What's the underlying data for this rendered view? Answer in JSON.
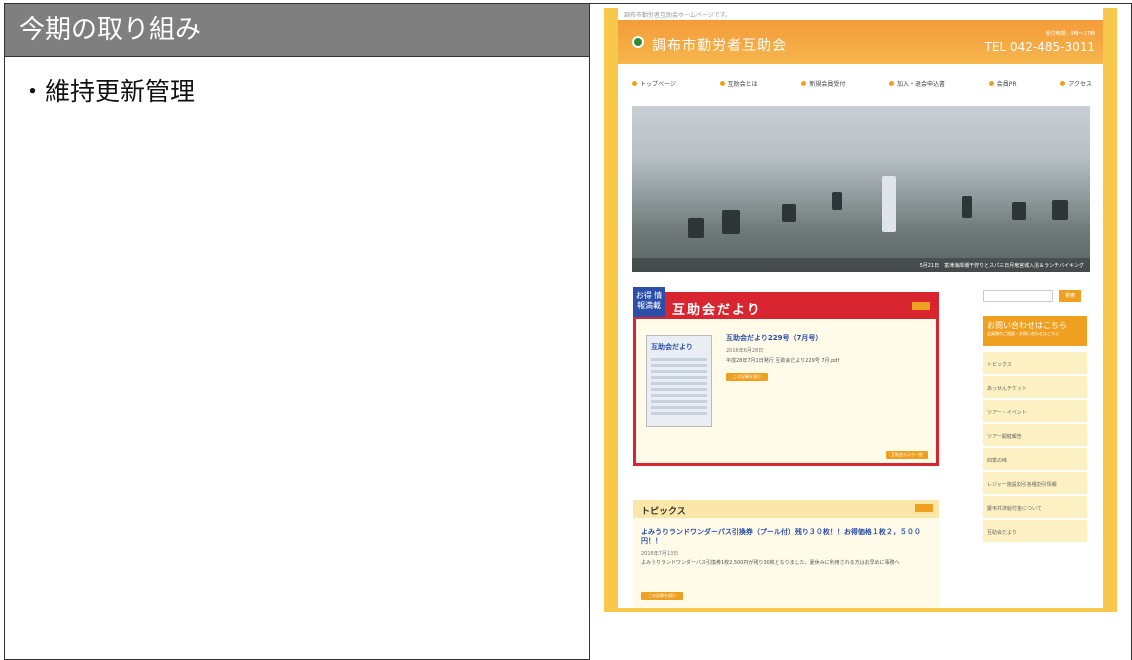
{
  "slide": {
    "header": "今期の取り組み",
    "bullet": "・維持更新管理"
  },
  "website": {
    "top_note": "調布市勤労者互助会ホームページです。",
    "title": "調布市勤労者互助会",
    "tel_note": "受付時間：9時～17時",
    "tel": "TEL 042-485-3011",
    "nav": [
      "トップページ",
      "互助会とは",
      "新規会員受付",
      "加入・退会申込書",
      "会員PR",
      "アクセス"
    ],
    "hero_caption": "5月21日　富津海岸潮干狩りとスパ三日月竜宮城入浴＆ランチバイキング",
    "news": {
      "badge": "お得 情報満載",
      "title": "互助会だより",
      "thumb_title": "互助会だより",
      "article_title": "互助会だより229号（7月号）",
      "article_date": "2016年6月28日",
      "article_text": "平成28年7月1日発行 互助会だより229号 7月.pdf",
      "more_button": "この記事を読む",
      "list_button": "互助会だより一覧"
    },
    "search_button": "検索",
    "contact": {
      "title": "お問い合わせはこちら",
      "sub": "会員様のご相談・お問い合わせはこちら"
    },
    "side_items": [
      "トピックス",
      "あっせんチケット",
      "ツアー・イベント",
      "ツアー開催報告",
      "四季の味",
      "レジャー施設割引各種割引情報",
      "慶弔共済給付金について",
      "互助会だより"
    ],
    "topics": {
      "title": "トピックス",
      "article_title": "よみうりランドワンダーパス引換券（プール付）残り３０枚！！お得価格１枚２，５００円！！",
      "date": "2016年7月13日",
      "text": "よみうりランドワンダーパス引換券1枚2,500円が残り30枚となりました。夏休みに利用される方はお早めに事務へ",
      "more_button": "この記事を読む"
    }
  }
}
